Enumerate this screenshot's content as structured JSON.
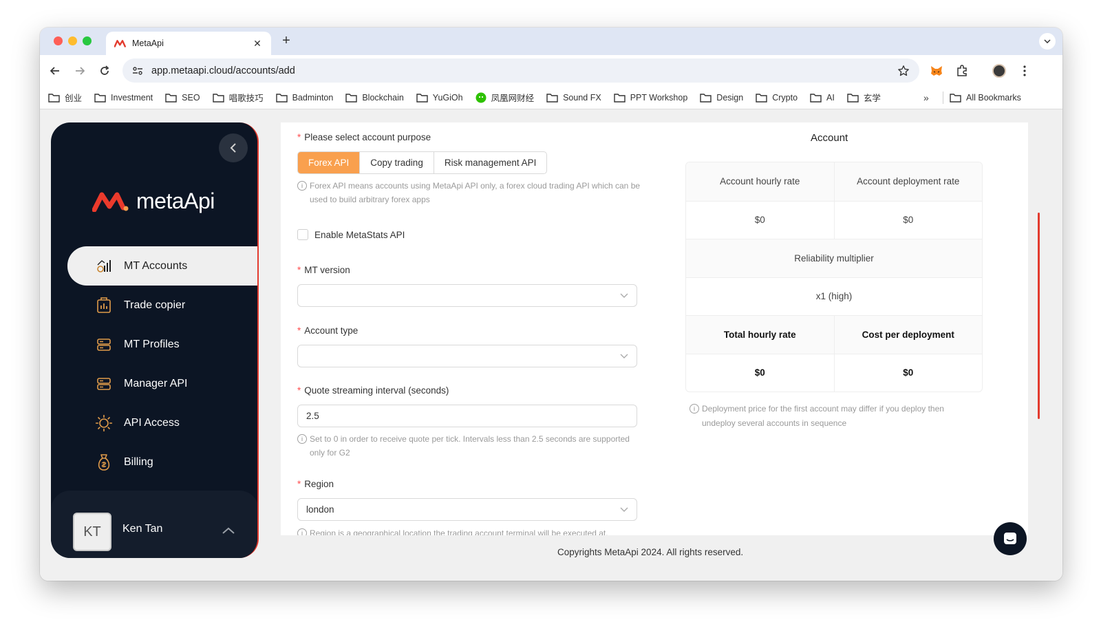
{
  "browser": {
    "tab_title": "MetaApi",
    "url": "app.metaapi.cloud/accounts/add",
    "bookmarks": [
      "创业",
      "Investment",
      "SEO",
      "唱歌技巧",
      "Badminton",
      "Blockchain",
      "YuGiOh",
      "凤凰网财经",
      "Sound FX",
      "PPT Workshop",
      "Design",
      "Crypto",
      "AI",
      "玄学"
    ],
    "all_bookmarks": "All Bookmarks",
    "more_bookmarks": "»"
  },
  "sidebar": {
    "logo_text": "metaApi",
    "items": [
      {
        "label": "MT Accounts",
        "icon": "chart-bars-icon"
      },
      {
        "label": "Trade copier",
        "icon": "copier-icon"
      },
      {
        "label": "MT Profiles",
        "icon": "server-icon"
      },
      {
        "label": "Manager API",
        "icon": "server-icon"
      },
      {
        "label": "API Access",
        "icon": "api-gear-icon"
      },
      {
        "label": "Billing",
        "icon": "money-bag-icon"
      }
    ],
    "user": {
      "initials": "KT",
      "name": "Ken Tan"
    }
  },
  "form": {
    "purpose_label": "Please select account purpose",
    "purpose_options": [
      "Forex API",
      "Copy trading",
      "Risk management API"
    ],
    "purpose_hint": "Forex API means accounts using MetaApi API only, a forex cloud trading API which can be used to build arbitrary forex apps",
    "metastats_label": "Enable MetaStats API",
    "mt_version_label": "MT version",
    "mt_version_value": "",
    "account_type_label": "Account type",
    "account_type_value": "",
    "quote_label": "Quote streaming interval (seconds)",
    "quote_value": "2.5",
    "quote_hint": "Set to 0 in order to receive quote per tick. Intervals less than 2.5 seconds are supported only for G2",
    "region_label": "Region",
    "region_value": "london",
    "region_hint": "Region is a geographical location the trading account terminal will be executed at."
  },
  "account": {
    "title": "Account",
    "hourly_rate_label": "Account hourly rate",
    "deployment_rate_label": "Account deployment rate",
    "hourly_rate": "$0",
    "deployment_rate": "$0",
    "reliability_label": "Reliability multiplier",
    "reliability_value": "x1 (high)",
    "total_hourly_label": "Total hourly rate",
    "cost_per_deployment_label": "Cost per deployment",
    "total_hourly": "$0",
    "cost_per_deployment": "$0",
    "hint": "Deployment price for the first account may differ if you deploy then undeploy several accounts in sequence"
  },
  "footer": "Copyrights MetaApi 2024. All rights reserved.",
  "colors": {
    "accent": "#f9a04e",
    "sidebar": "#0c1524",
    "brand_red": "#e33b2e"
  }
}
